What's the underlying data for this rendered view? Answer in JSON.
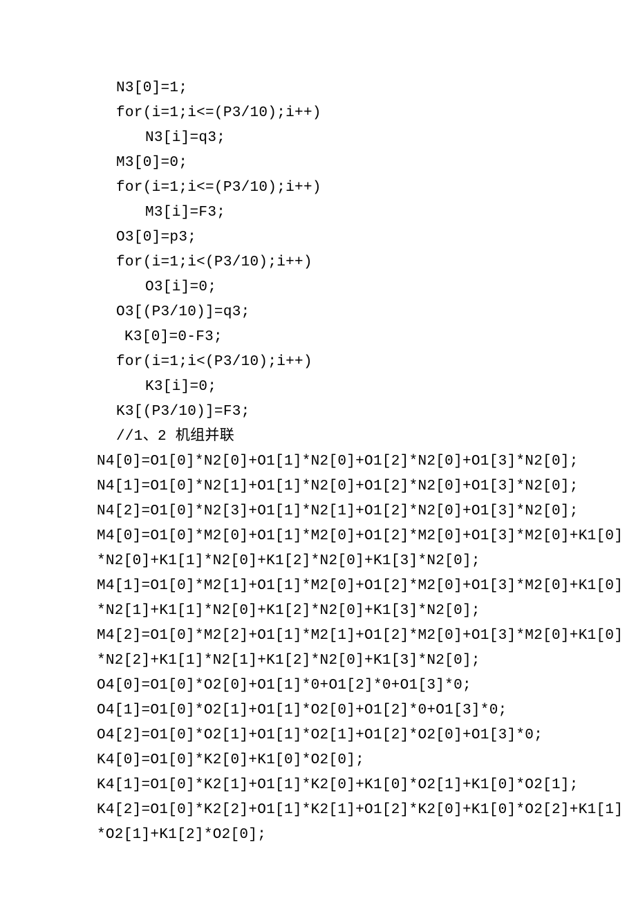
{
  "lines": [
    {
      "cls": "indent1",
      "text": "N3[0]=1;"
    },
    {
      "cls": "indent1",
      "text": "for(i=1;i<=(P3/10);i++)"
    },
    {
      "cls": "indent2",
      "text": "N3[i]=q3;"
    },
    {
      "cls": "indent1",
      "text": "M3[0]=0;"
    },
    {
      "cls": "indent1",
      "text": "for(i=1;i<=(P3/10);i++)"
    },
    {
      "cls": "indent2",
      "text": "M3[i]=F3;"
    },
    {
      "cls": "indent1",
      "text": "O3[0]=p3;"
    },
    {
      "cls": "indent1",
      "text": "for(i=1;i<(P3/10);i++)"
    },
    {
      "cls": "indent2",
      "text": "O3[i]=0;"
    },
    {
      "cls": "indent1",
      "text": "O3[(P3/10)]=q3;"
    },
    {
      "cls": "indent1b",
      "text": "K3[0]=0-F3;"
    },
    {
      "cls": "indent1",
      "text": "for(i=1;i<(P3/10);i++)"
    },
    {
      "cls": "indent2",
      "text": "K3[i]=0;"
    },
    {
      "cls": "indent1",
      "text": "K3[(P3/10)]=F3;"
    },
    {
      "cls": "indent1",
      "text": "//1、2 机组并联"
    },
    {
      "cls": "",
      "text": "N4[0]=O1[0]*N2[0]+O1[1]*N2[0]+O1[2]*N2[0]+O1[3]*N2[0];"
    },
    {
      "cls": "",
      "text": "N4[1]=O1[0]*N2[1]+O1[1]*N2[0]+O1[2]*N2[0]+O1[3]*N2[0];"
    },
    {
      "cls": "",
      "text": "N4[2]=O1[0]*N2[3]+O1[1]*N2[1]+O1[2]*N2[0]+O1[3]*N2[0];"
    },
    {
      "cls": "",
      "text": "M4[0]=O1[0]*M2[0]+O1[1]*M2[0]+O1[2]*M2[0]+O1[3]*M2[0]+K1[0]"
    },
    {
      "cls": "",
      "text": "*N2[0]+K1[1]*N2[0]+K1[2]*N2[0]+K1[3]*N2[0];"
    },
    {
      "cls": "",
      "text": "M4[1]=O1[0]*M2[1]+O1[1]*M2[0]+O1[2]*M2[0]+O1[3]*M2[0]+K1[0]"
    },
    {
      "cls": "",
      "text": "*N2[1]+K1[1]*N2[0]+K1[2]*N2[0]+K1[3]*N2[0];"
    },
    {
      "cls": "",
      "text": "M4[2]=O1[0]*M2[2]+O1[1]*M2[1]+O1[2]*M2[0]+O1[3]*M2[0]+K1[0]"
    },
    {
      "cls": "",
      "text": "*N2[2]+K1[1]*N2[1]+K1[2]*N2[0]+K1[3]*N2[0];"
    },
    {
      "cls": "",
      "text": "O4[0]=O1[0]*O2[0]+O1[1]*0+O1[2]*0+O1[3]*0;"
    },
    {
      "cls": "",
      "text": "O4[1]=O1[0]*O2[1]+O1[1]*O2[0]+O1[2]*0+O1[3]*0;"
    },
    {
      "cls": "",
      "text": "O4[2]=O1[0]*O2[1]+O1[1]*O2[1]+O1[2]*O2[0]+O1[3]*0;"
    },
    {
      "cls": "",
      "text": "K4[0]=O1[0]*K2[0]+K1[0]*O2[0];"
    },
    {
      "cls": "",
      "text": "K4[1]=O1[0]*K2[1]+O1[1]*K2[0]+K1[0]*O2[1]+K1[0]*O2[1];"
    },
    {
      "cls": "",
      "text": "K4[2]=O1[0]*K2[2]+O1[1]*K2[1]+O1[2]*K2[0]+K1[0]*O2[2]+K1[1]"
    },
    {
      "cls": "",
      "text": "*O2[1]+K1[2]*O2[0];"
    }
  ]
}
